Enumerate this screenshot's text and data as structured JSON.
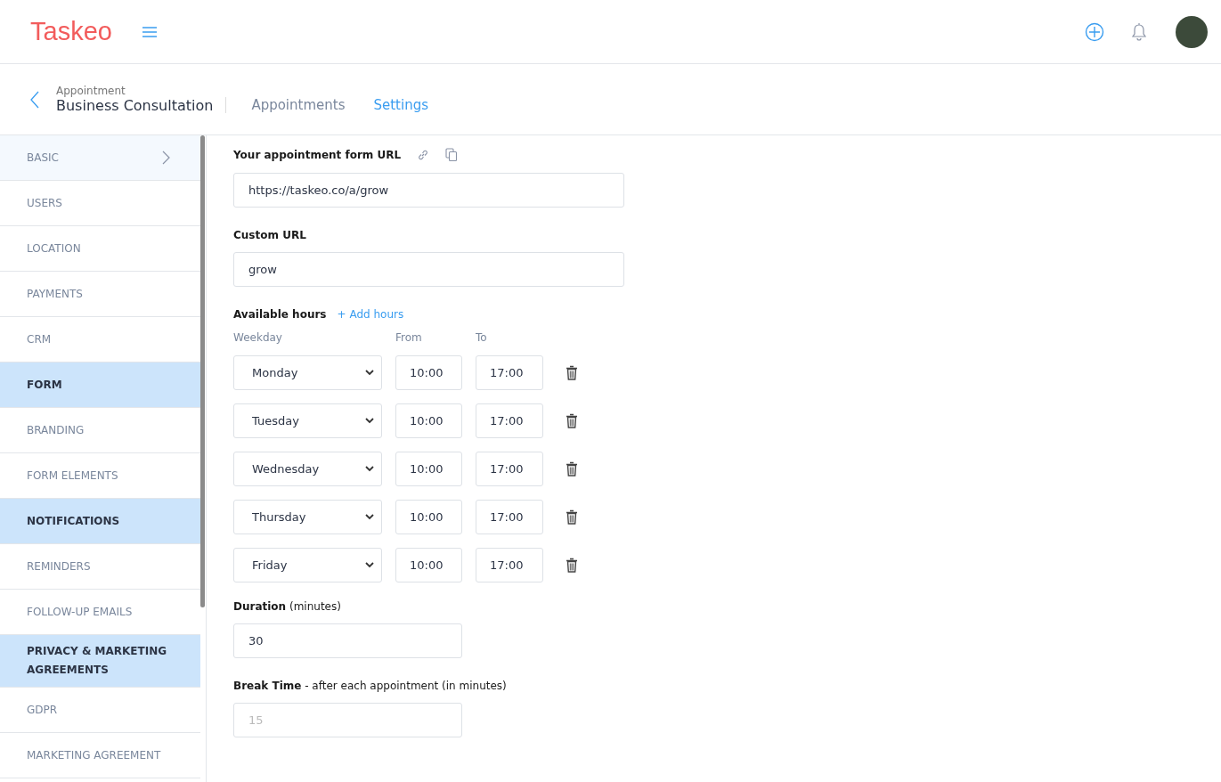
{
  "header": {
    "logo": "Taskeo"
  },
  "breadcrumb": {
    "parent": "Appointment",
    "title": "Business Consultation"
  },
  "tabs": [
    {
      "label": "Appointments",
      "selected": false
    },
    {
      "label": "Settings",
      "selected": true
    }
  ],
  "sidebar": {
    "items": [
      {
        "label": "BASIC",
        "kind": "item",
        "selected": true
      },
      {
        "label": "USERS",
        "kind": "item",
        "selected": false
      },
      {
        "label": "LOCATION",
        "kind": "item",
        "selected": false
      },
      {
        "label": "PAYMENTS",
        "kind": "item",
        "selected": false
      },
      {
        "label": "CRM",
        "kind": "item",
        "selected": false
      },
      {
        "label": "FORM",
        "kind": "section",
        "selected": false
      },
      {
        "label": "BRANDING",
        "kind": "item",
        "selected": false
      },
      {
        "label": "FORM ELEMENTS",
        "kind": "item",
        "selected": false
      },
      {
        "label": "NOTIFICATIONS",
        "kind": "section",
        "selected": false
      },
      {
        "label": "REMINDERS",
        "kind": "item",
        "selected": false
      },
      {
        "label": "FOLLOW-UP EMAILS",
        "kind": "item",
        "selected": false
      },
      {
        "label": "PRIVACY & MARKETING AGREEMENTS",
        "kind": "section",
        "selected": false
      },
      {
        "label": "GDPR",
        "kind": "item",
        "selected": false
      },
      {
        "label": "MARKETING AGREEMENT",
        "kind": "item",
        "selected": false
      }
    ]
  },
  "form": {
    "url_label": "Your appointment form URL",
    "url_value": "https://taskeo.co/a/grow",
    "custom_label": "Custom URL",
    "custom_value": "grow",
    "hours_label": "Available hours",
    "add_hours": "+ Add hours",
    "columns": [
      "Weekday",
      "From",
      "To"
    ],
    "hours": [
      {
        "day": "Monday",
        "from": "10:00",
        "to": "17:00"
      },
      {
        "day": "Tuesday",
        "from": "10:00",
        "to": "17:00"
      },
      {
        "day": "Wednesday",
        "from": "10:00",
        "to": "17:00"
      },
      {
        "day": "Thursday",
        "from": "10:00",
        "to": "17:00"
      },
      {
        "day": "Friday",
        "from": "10:00",
        "to": "17:00"
      }
    ],
    "duration_label": "**Duration** (minutes)",
    "duration_value": "30",
    "break_label": "**Break Time** - after each appointment (in minutes)",
    "break_placeholder": "15"
  }
}
